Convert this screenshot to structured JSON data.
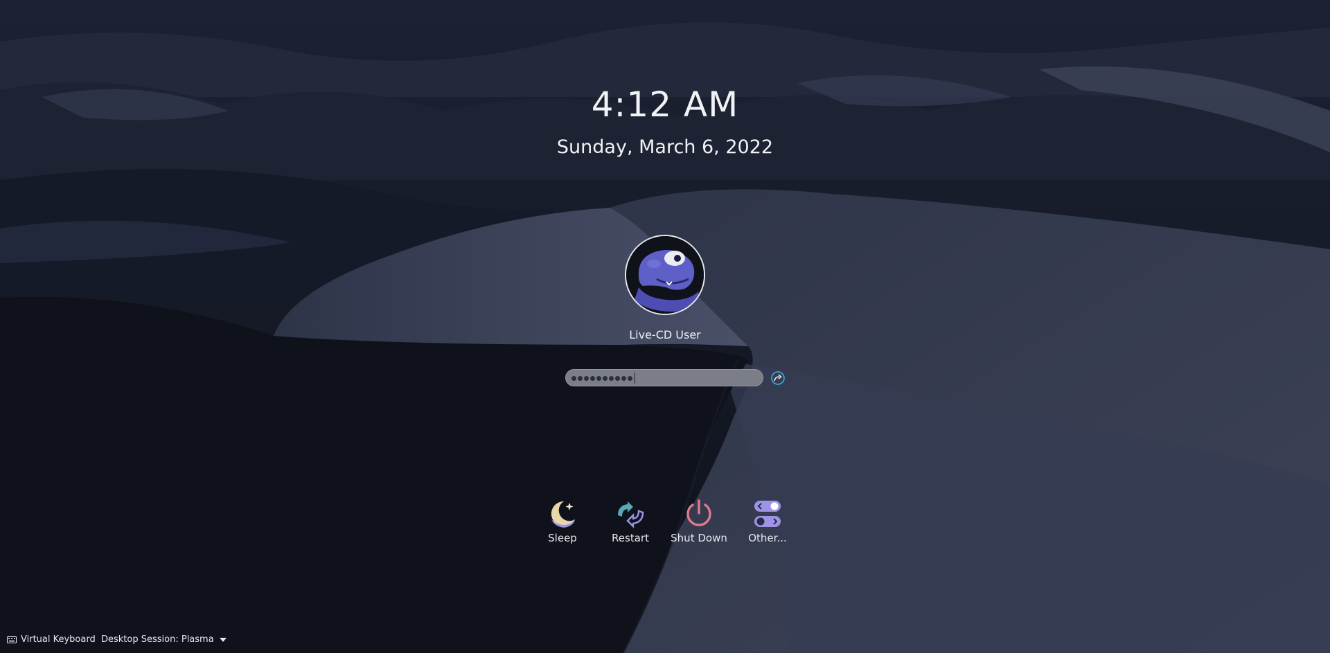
{
  "clock": {
    "time": "4:12 AM",
    "date": "Sunday, March 6, 2022"
  },
  "user": {
    "name": "Live-CD User",
    "avatar_icon": "chameleon-mascot-avatar"
  },
  "password": {
    "masked_length": 10,
    "login_icon": "login-arrow-icon"
  },
  "actions": [
    {
      "label": "Sleep",
      "icon": "moon-icon"
    },
    {
      "label": "Restart",
      "icon": "restart-icon"
    },
    {
      "label": "Shut Down",
      "icon": "power-icon"
    },
    {
      "label": "Other...",
      "icon": "switch-toggle-icon"
    }
  ],
  "bottom_bar": {
    "virtual_keyboard_label": "Virtual Keyboard",
    "session_label": "Desktop Session: Plasma"
  },
  "colors": {
    "accent": "#3daee9",
    "sleep": "#e8d5a8",
    "restart": "#5aa8b8",
    "shutdown": "#e07a8e",
    "other": "#9d94e6"
  }
}
